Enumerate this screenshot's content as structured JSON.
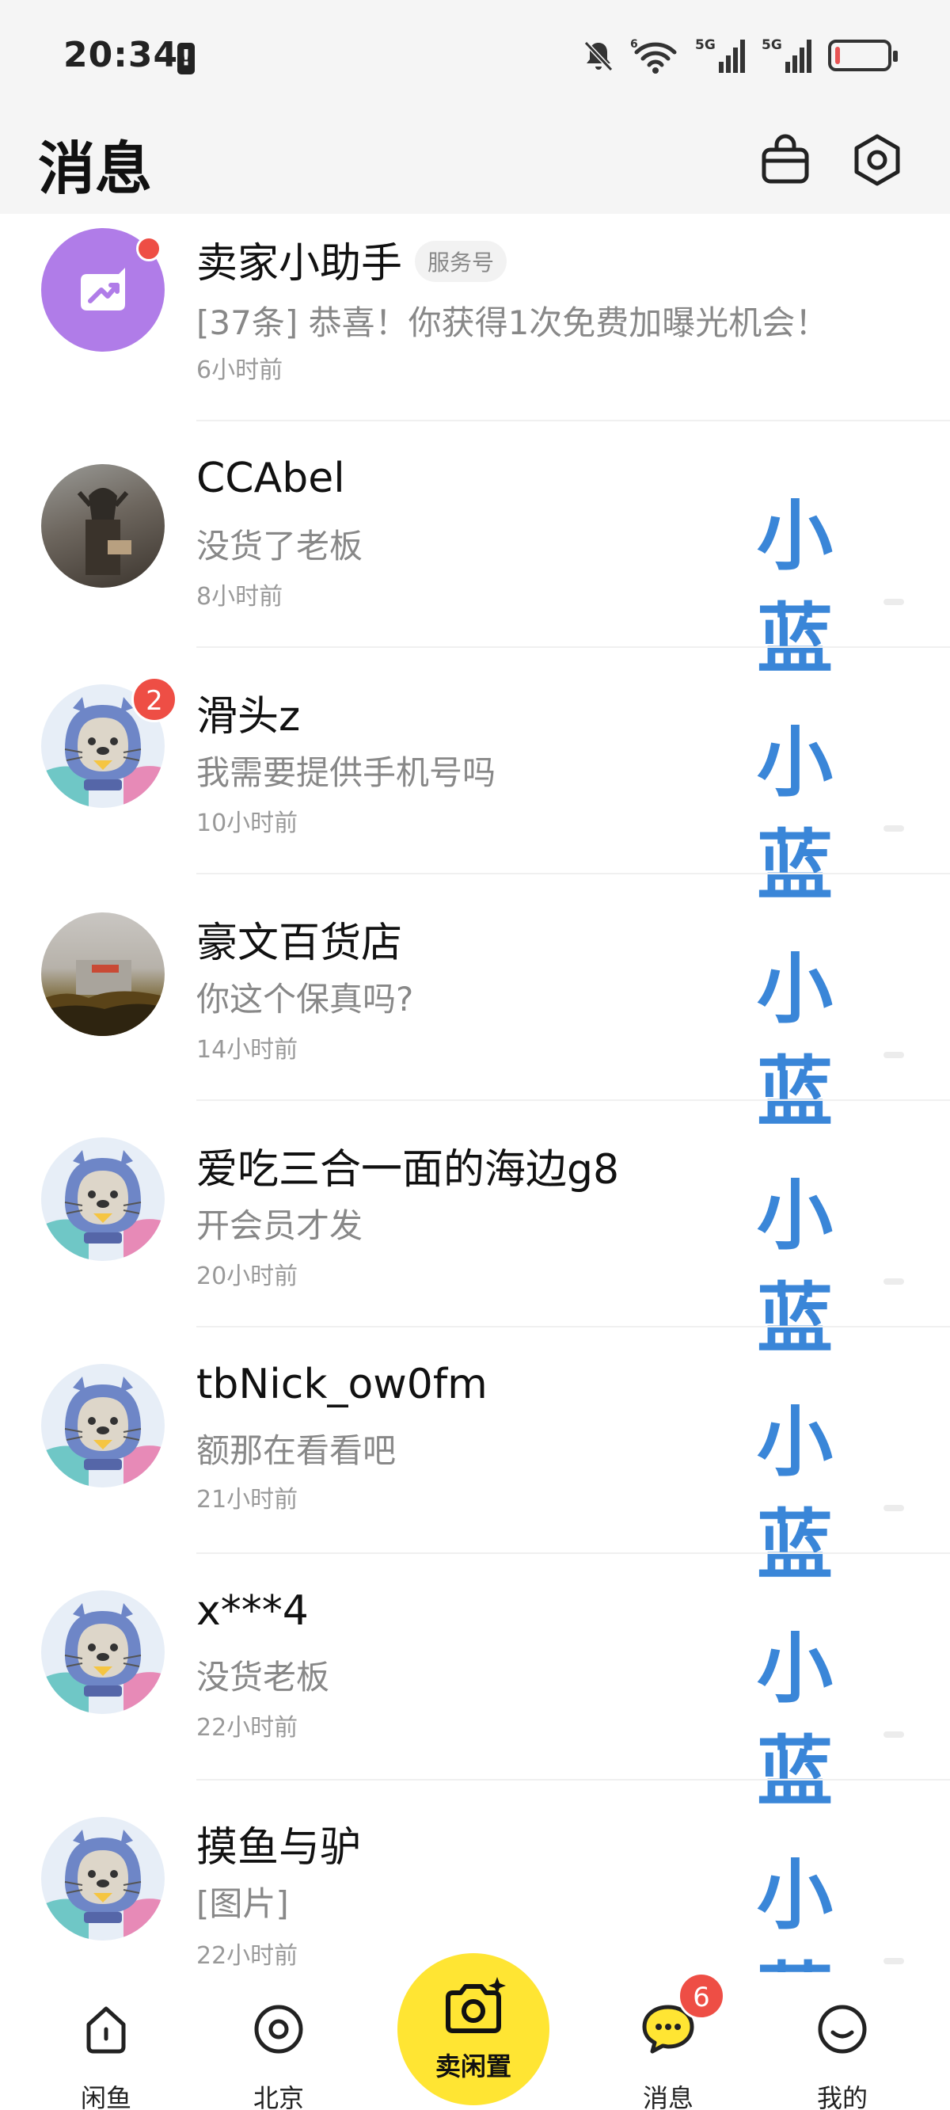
{
  "status_bar": {
    "time": "20:34",
    "network_1": "5G",
    "network_2": "5G",
    "wifi_label": "6",
    "battery_level": 0.1
  },
  "header": {
    "title": "消息"
  },
  "conversations": [
    {
      "name": "卖家小助手",
      "tag": "服务号",
      "message": "[37条] 恭喜！你获得1次免费加曝光机会！",
      "time": "6小时前",
      "unread_dot": true
    },
    {
      "name": "CCAbel",
      "message": "没货了老板",
      "time": "8小时前",
      "thumb": "小蓝"
    },
    {
      "name": "滑头z",
      "message": "我需要提供手机号吗",
      "time": "10小时前",
      "badge": "2",
      "thumb": "小蓝"
    },
    {
      "name": "豪文百货店",
      "message": "你这个保真吗?",
      "time": "14小时前",
      "thumb": "小蓝"
    },
    {
      "name": "爱吃三合一面的海边g8",
      "message": "开会员才发",
      "time": "20小时前",
      "thumb": "小蓝"
    },
    {
      "name": "tbNick_ow0fm",
      "message": "额那在看看吧",
      "time": "21小时前",
      "thumb": "小蓝"
    },
    {
      "name": "x***4",
      "message": "没货老板",
      "time": "22小时前",
      "thumb": "小蓝"
    },
    {
      "name": "摸鱼与驴",
      "message": "[图片]",
      "time": "22小时前",
      "thumb": "小蓝"
    }
  ],
  "tab_bar": {
    "home": "闲鱼",
    "city": "北京",
    "sell": "卖闲置",
    "messages": "消息",
    "messages_badge": "6",
    "me": "我的"
  },
  "colors": {
    "accent_yellow": "#ffe533",
    "badge_red": "#ee4e45",
    "thumb_blue": "#3a86d8",
    "assistant_purple": "#b07ce8"
  }
}
